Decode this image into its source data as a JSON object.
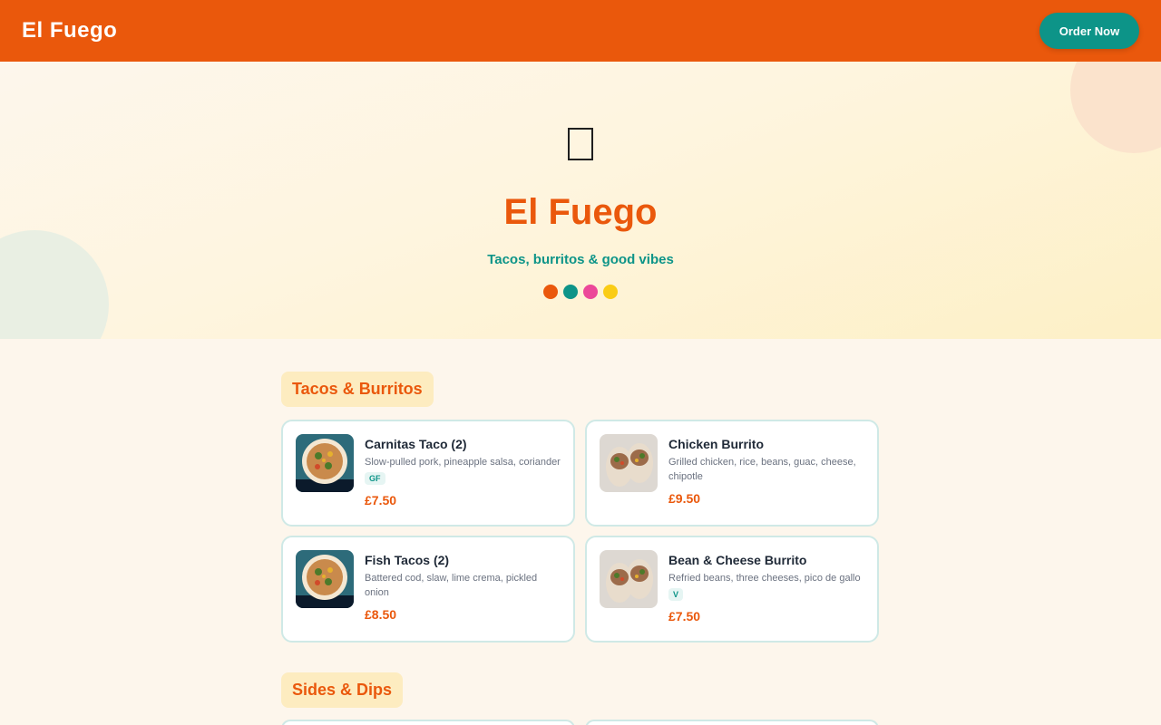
{
  "header": {
    "brand": "El Fuego",
    "order_button": "Order Now"
  },
  "hero": {
    "icon": "taco-icon",
    "title": "El Fuego",
    "tagline": "Tacos, burritos & good vibes",
    "dots": [
      "#ea580c",
      "#0d9488",
      "#ec4899",
      "#facc15"
    ]
  },
  "colors": {
    "brand_orange": "#ea580c",
    "teal": "#0d9488",
    "cream": "#fdf6ec"
  },
  "sections": [
    {
      "label": "Tacos & Burritos",
      "items": [
        {
          "name": "Carnitas Taco (2)",
          "desc": "Slow-pulled pork, pineapple salsa, coriander",
          "tag": "GF",
          "price": "£7.50",
          "image": "taco-photo"
        },
        {
          "name": "Chicken Burrito",
          "desc": "Grilled chicken, rice, beans, guac, cheese, chipotle",
          "tag": "",
          "price": "£9.50",
          "image": "burrito-photo"
        },
        {
          "name": "Fish Tacos (2)",
          "desc": "Battered cod, slaw, lime crema, pickled onion",
          "tag": "",
          "price": "£8.50",
          "image": "taco-photo"
        },
        {
          "name": "Bean & Cheese Burrito",
          "desc": "Refried beans, three cheeses, pico de gallo",
          "tag": "V",
          "price": "£7.50",
          "image": "burrito-photo"
        }
      ]
    },
    {
      "label": "Sides & Dips",
      "items": []
    }
  ]
}
